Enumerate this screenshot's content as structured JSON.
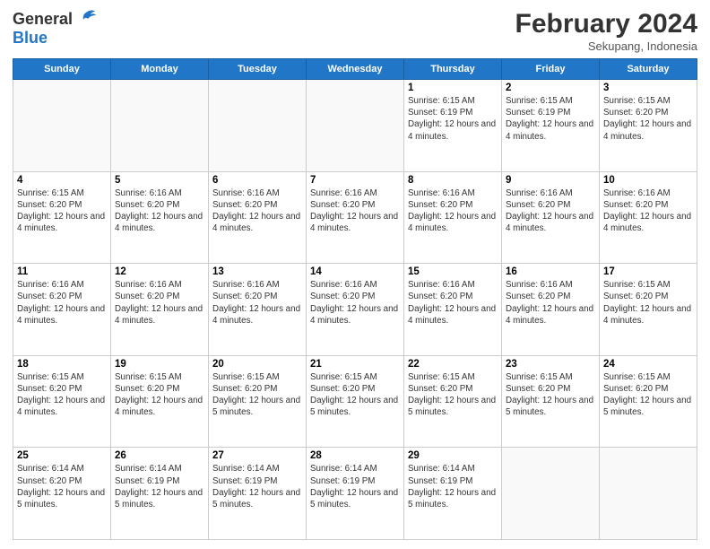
{
  "header": {
    "logo_general": "General",
    "logo_blue": "Blue",
    "month_title": "February 2024",
    "location": "Sekupang, Indonesia"
  },
  "days_of_week": [
    "Sunday",
    "Monday",
    "Tuesday",
    "Wednesday",
    "Thursday",
    "Friday",
    "Saturday"
  ],
  "weeks": [
    [
      {
        "day": "",
        "info": ""
      },
      {
        "day": "",
        "info": ""
      },
      {
        "day": "",
        "info": ""
      },
      {
        "day": "",
        "info": ""
      },
      {
        "day": "1",
        "info": "Sunrise: 6:15 AM\nSunset: 6:19 PM\nDaylight: 12 hours and 4 minutes."
      },
      {
        "day": "2",
        "info": "Sunrise: 6:15 AM\nSunset: 6:19 PM\nDaylight: 12 hours and 4 minutes."
      },
      {
        "day": "3",
        "info": "Sunrise: 6:15 AM\nSunset: 6:20 PM\nDaylight: 12 hours and 4 minutes."
      }
    ],
    [
      {
        "day": "4",
        "info": "Sunrise: 6:15 AM\nSunset: 6:20 PM\nDaylight: 12 hours and 4 minutes."
      },
      {
        "day": "5",
        "info": "Sunrise: 6:16 AM\nSunset: 6:20 PM\nDaylight: 12 hours and 4 minutes."
      },
      {
        "day": "6",
        "info": "Sunrise: 6:16 AM\nSunset: 6:20 PM\nDaylight: 12 hours and 4 minutes."
      },
      {
        "day": "7",
        "info": "Sunrise: 6:16 AM\nSunset: 6:20 PM\nDaylight: 12 hours and 4 minutes."
      },
      {
        "day": "8",
        "info": "Sunrise: 6:16 AM\nSunset: 6:20 PM\nDaylight: 12 hours and 4 minutes."
      },
      {
        "day": "9",
        "info": "Sunrise: 6:16 AM\nSunset: 6:20 PM\nDaylight: 12 hours and 4 minutes."
      },
      {
        "day": "10",
        "info": "Sunrise: 6:16 AM\nSunset: 6:20 PM\nDaylight: 12 hours and 4 minutes."
      }
    ],
    [
      {
        "day": "11",
        "info": "Sunrise: 6:16 AM\nSunset: 6:20 PM\nDaylight: 12 hours and 4 minutes."
      },
      {
        "day": "12",
        "info": "Sunrise: 6:16 AM\nSunset: 6:20 PM\nDaylight: 12 hours and 4 minutes."
      },
      {
        "day": "13",
        "info": "Sunrise: 6:16 AM\nSunset: 6:20 PM\nDaylight: 12 hours and 4 minutes."
      },
      {
        "day": "14",
        "info": "Sunrise: 6:16 AM\nSunset: 6:20 PM\nDaylight: 12 hours and 4 minutes."
      },
      {
        "day": "15",
        "info": "Sunrise: 6:16 AM\nSunset: 6:20 PM\nDaylight: 12 hours and 4 minutes."
      },
      {
        "day": "16",
        "info": "Sunrise: 6:16 AM\nSunset: 6:20 PM\nDaylight: 12 hours and 4 minutes."
      },
      {
        "day": "17",
        "info": "Sunrise: 6:15 AM\nSunset: 6:20 PM\nDaylight: 12 hours and 4 minutes."
      }
    ],
    [
      {
        "day": "18",
        "info": "Sunrise: 6:15 AM\nSunset: 6:20 PM\nDaylight: 12 hours and 4 minutes."
      },
      {
        "day": "19",
        "info": "Sunrise: 6:15 AM\nSunset: 6:20 PM\nDaylight: 12 hours and 4 minutes."
      },
      {
        "day": "20",
        "info": "Sunrise: 6:15 AM\nSunset: 6:20 PM\nDaylight: 12 hours and 5 minutes."
      },
      {
        "day": "21",
        "info": "Sunrise: 6:15 AM\nSunset: 6:20 PM\nDaylight: 12 hours and 5 minutes."
      },
      {
        "day": "22",
        "info": "Sunrise: 6:15 AM\nSunset: 6:20 PM\nDaylight: 12 hours and 5 minutes."
      },
      {
        "day": "23",
        "info": "Sunrise: 6:15 AM\nSunset: 6:20 PM\nDaylight: 12 hours and 5 minutes."
      },
      {
        "day": "24",
        "info": "Sunrise: 6:15 AM\nSunset: 6:20 PM\nDaylight: 12 hours and 5 minutes."
      }
    ],
    [
      {
        "day": "25",
        "info": "Sunrise: 6:14 AM\nSunset: 6:20 PM\nDaylight: 12 hours and 5 minutes."
      },
      {
        "day": "26",
        "info": "Sunrise: 6:14 AM\nSunset: 6:19 PM\nDaylight: 12 hours and 5 minutes."
      },
      {
        "day": "27",
        "info": "Sunrise: 6:14 AM\nSunset: 6:19 PM\nDaylight: 12 hours and 5 minutes."
      },
      {
        "day": "28",
        "info": "Sunrise: 6:14 AM\nSunset: 6:19 PM\nDaylight: 12 hours and 5 minutes."
      },
      {
        "day": "29",
        "info": "Sunrise: 6:14 AM\nSunset: 6:19 PM\nDaylight: 12 hours and 5 minutes."
      },
      {
        "day": "",
        "info": ""
      },
      {
        "day": "",
        "info": ""
      }
    ]
  ]
}
